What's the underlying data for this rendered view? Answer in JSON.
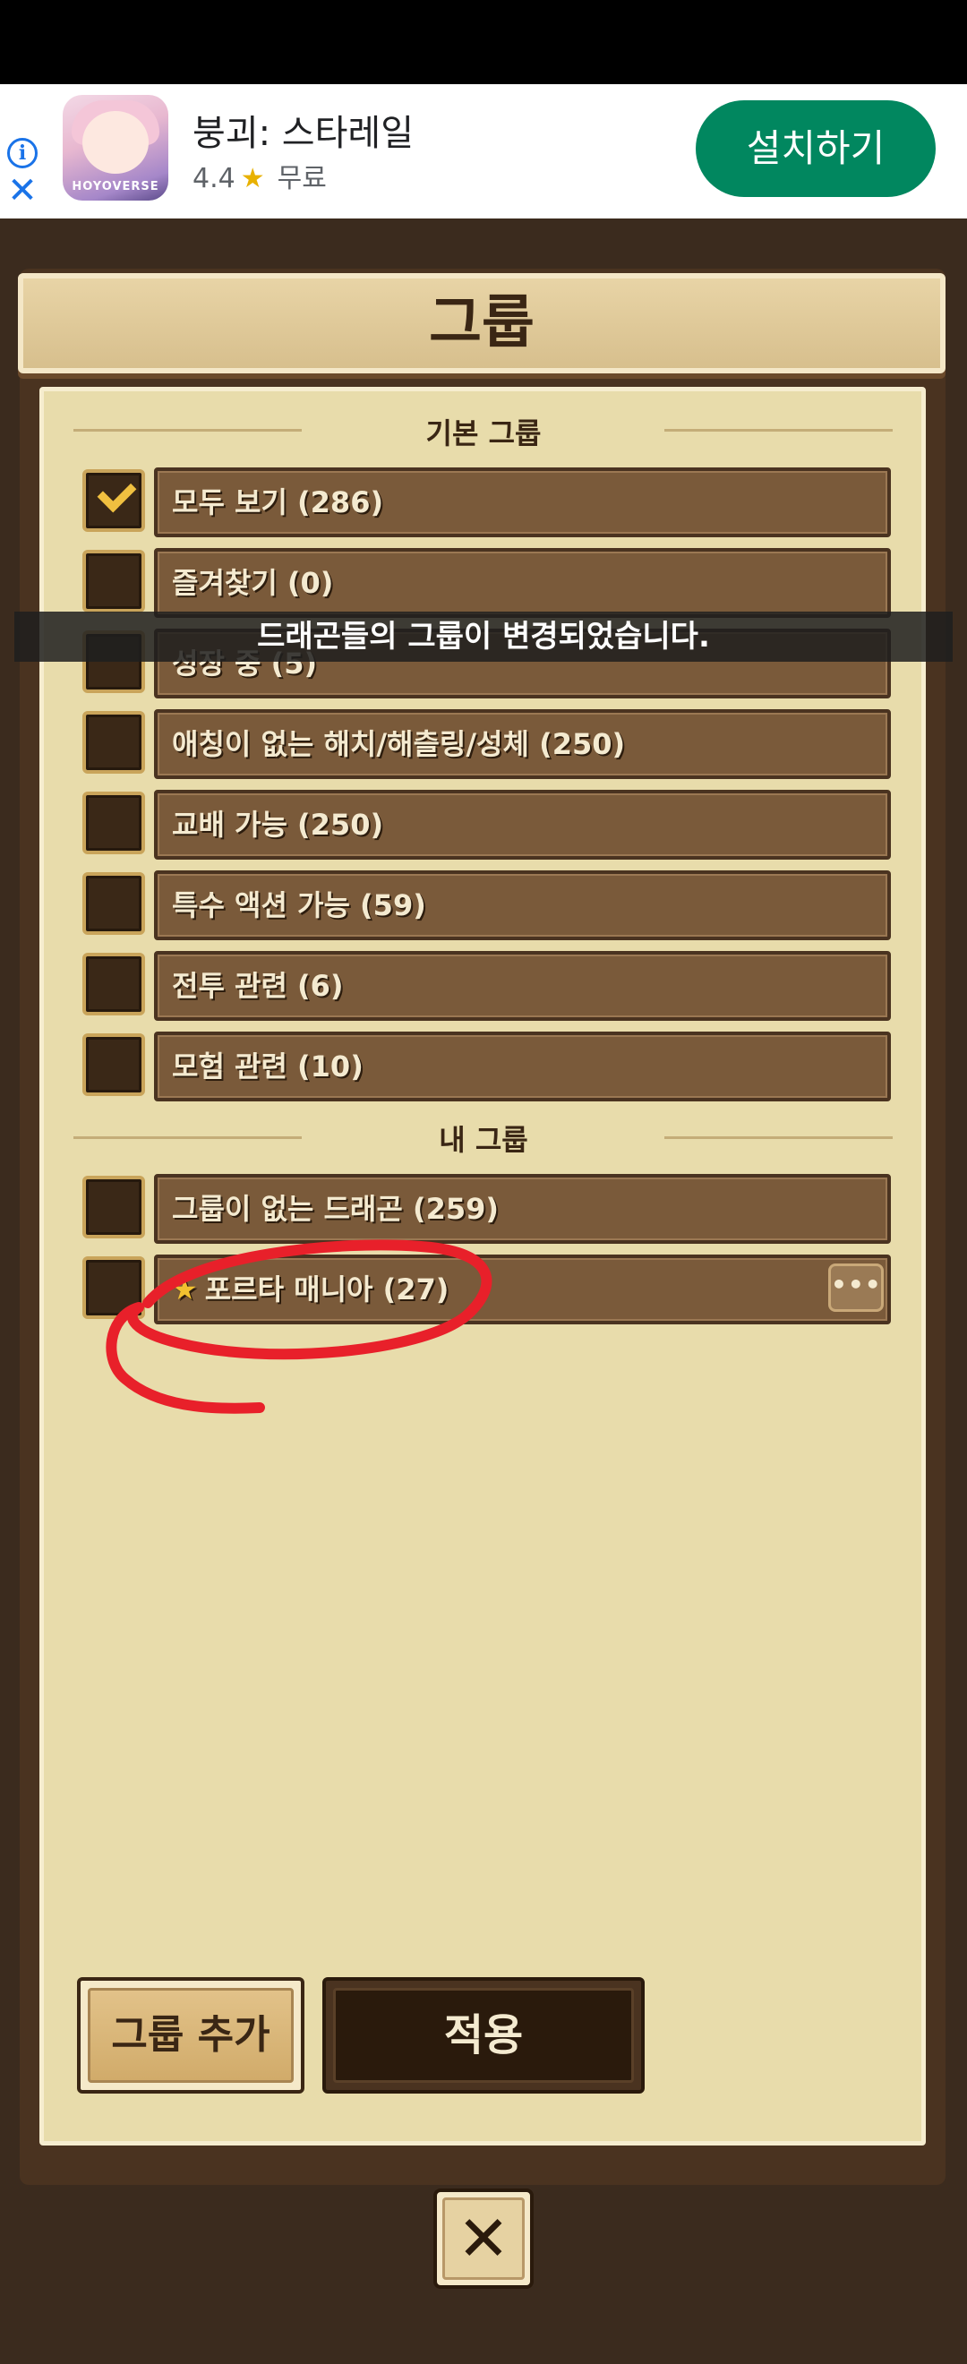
{
  "ad": {
    "app_name": "붕괴: 스타레일",
    "rating": "4.4",
    "price": "무료",
    "install_label": "설치하기",
    "icon_brand": "HOYOVERSE",
    "info_glyph": "i",
    "close_glyph": "✕",
    "star_glyph": "★"
  },
  "dialog": {
    "title": "그룹",
    "toast": "드래곤들의 그룹이 변경되었습니다."
  },
  "basic_groups": {
    "title": "기본 그룹",
    "items": [
      {
        "label": "모두 보기 (286)",
        "checked": true
      },
      {
        "label": "즐겨찾기 (0)",
        "checked": false
      },
      {
        "label": "성장 중 (5)",
        "checked": false
      },
      {
        "label": "애칭이 없는 해치/해츨링/성체 (250)",
        "checked": false
      },
      {
        "label": "교배 가능 (250)",
        "checked": false
      },
      {
        "label": "특수 액션 가능 (59)",
        "checked": false
      },
      {
        "label": "전투 관련 (6)",
        "checked": false
      },
      {
        "label": "모험 관련 (10)",
        "checked": false
      }
    ]
  },
  "my_groups": {
    "title": "내 그룹",
    "items": [
      {
        "label": "그룹이 없는 드래곤 (259)",
        "checked": false
      },
      {
        "label": "포르타 매니아 (27)",
        "checked": false,
        "starred": true,
        "more": "•••"
      }
    ]
  },
  "buttons": {
    "add_group": "그룹 추가",
    "apply": "적용",
    "close_glyph": "✕"
  },
  "colors": {
    "install_button": "#01875f",
    "annotation_stroke": "#e8202a",
    "checkmark": "#f0c040"
  }
}
